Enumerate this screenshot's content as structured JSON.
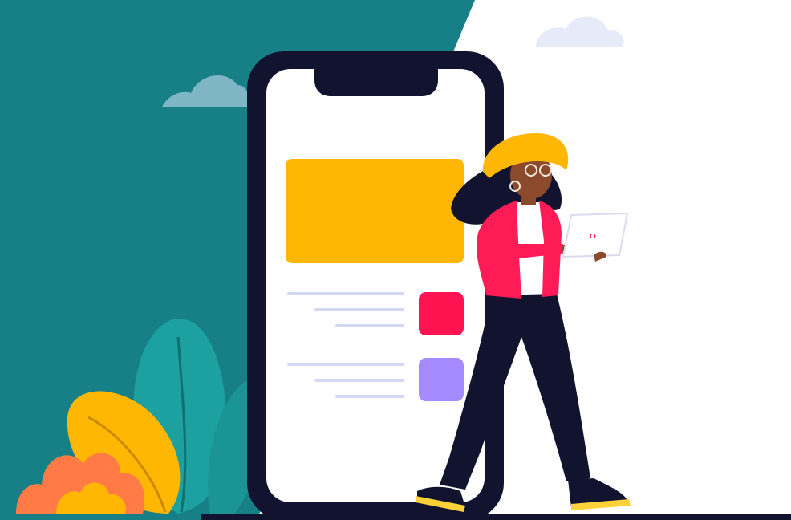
{
  "colors": {
    "teal": "#177f86",
    "white": "#ffffff",
    "cloud": "#e7eaf8",
    "cloud_on_teal": "#7fb6c6",
    "phone_frame": "#12132f",
    "phone_screen": "#ffffff",
    "card_yellow": "#ffb703",
    "square_red": "#ff1350",
    "square_purple": "#a48afc",
    "line_lavender": "#d4d9f5",
    "jacket_pink": "#ff1c56",
    "pants_navy": "#12132f",
    "hat_yellow": "#ffb703",
    "skin": "#8a4a2b",
    "hair": "#12132f",
    "leaf_teal": "#1ca0a0",
    "leaf_yellow": "#ffb703",
    "leaf_orange": "#ff7a45",
    "ground": "#12132f"
  },
  "icons": {
    "laptop_code": "code-icon"
  }
}
